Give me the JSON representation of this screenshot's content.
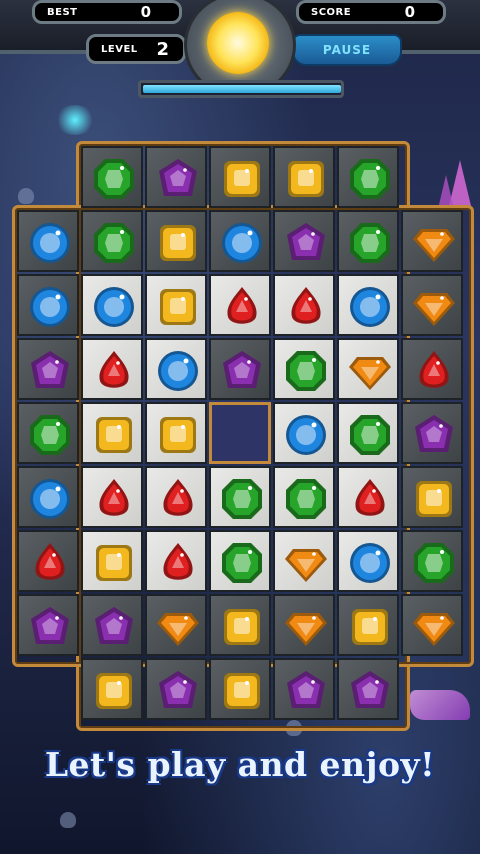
{
  "hud": {
    "best_label": "BEST",
    "best_value": "0",
    "score_label": "SCORE",
    "score_value": "0",
    "level_label": "LEVEL",
    "level_value": "2",
    "pause_label": "PAUSE",
    "progress_fraction": 0.99
  },
  "tagline": "Let's play and enjoy!",
  "colors": {
    "green": "#27a52a",
    "purple": "#8a2fb0",
    "yellow": "#f2b81e",
    "blue": "#1f86e0",
    "red": "#e02020",
    "orange": "#f08a12",
    "frame": "#c28a3a"
  },
  "board": {
    "rows": [
      [
        null,
        "green",
        "purple",
        "yellow",
        "yellow",
        "green",
        null
      ],
      [
        "blue",
        "green",
        "yellow",
        "blue",
        "purple",
        "green",
        "orange"
      ],
      [
        "blue",
        "blue",
        "yellow",
        "red",
        "red",
        "blue",
        "orange"
      ],
      [
        "purple",
        "red",
        "blue",
        "purple",
        "green",
        "orange",
        "red"
      ],
      [
        "green",
        "yellow",
        "yellow",
        "empty",
        "blue",
        "green",
        "purple"
      ],
      [
        "blue",
        "red",
        "red",
        "green",
        "green",
        "red",
        "yellow"
      ],
      [
        "red",
        "yellow",
        "red",
        "green",
        "orange",
        "blue",
        "green"
      ],
      [
        "purple",
        "purple",
        "orange",
        "yellow",
        "orange",
        "yellow",
        "orange"
      ],
      [
        null,
        "yellow",
        "purple",
        "yellow",
        "purple",
        "purple",
        null
      ]
    ],
    "shades": [
      [
        null,
        "d",
        "d",
        "d",
        "d",
        "d",
        null
      ],
      [
        "d",
        "d",
        "d",
        "d",
        "d",
        "d",
        "d"
      ],
      [
        "d",
        "l",
        "l",
        "l",
        "l",
        "l",
        "d"
      ],
      [
        "d",
        "l",
        "l",
        "d",
        "l",
        "l",
        "d"
      ],
      [
        "d",
        "l",
        "l",
        "e",
        "l",
        "l",
        "d"
      ],
      [
        "d",
        "l",
        "l",
        "l",
        "l",
        "l",
        "d"
      ],
      [
        "d",
        "l",
        "l",
        "l",
        "l",
        "l",
        "d"
      ],
      [
        "d",
        "d",
        "d",
        "d",
        "d",
        "d",
        "d"
      ],
      [
        null,
        "d",
        "d",
        "d",
        "d",
        "d",
        null
      ]
    ]
  }
}
